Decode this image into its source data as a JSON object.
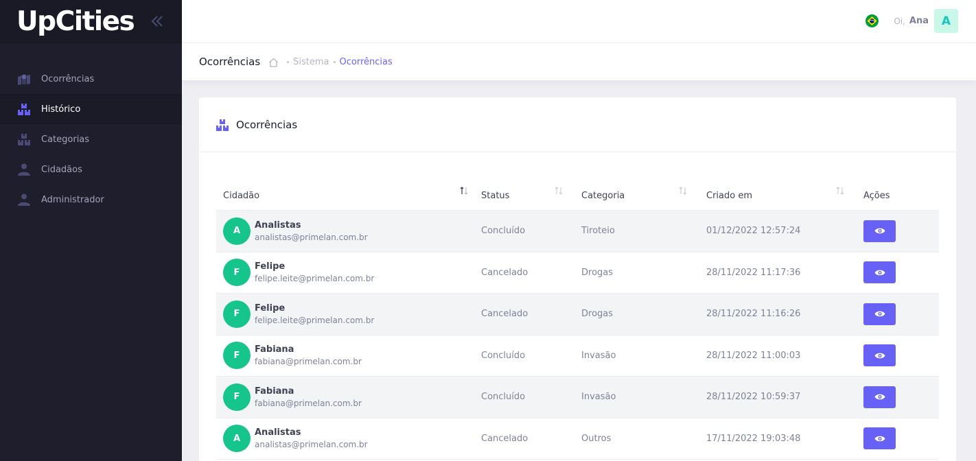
{
  "brand": {
    "logo_text": "UpCities"
  },
  "sidebar": {
    "items": [
      {
        "label": "Ocorrências",
        "icon": "map-pin-icon",
        "active": false
      },
      {
        "label": "Histórico",
        "icon": "boxes-icon",
        "active": true
      },
      {
        "label": "Categorias",
        "icon": "boxes-icon",
        "active": false
      },
      {
        "label": "Cidadãos",
        "icon": "user-icon",
        "active": false
      },
      {
        "label": "Administrador",
        "icon": "user-icon",
        "active": false
      }
    ]
  },
  "header": {
    "greeting": "Oi,",
    "user_name": "Ana",
    "user_initial": "A",
    "language_flag": "brazil-flag-icon"
  },
  "subheader": {
    "title": "Ocorrências",
    "breadcrumb": [
      "Sistema",
      "Ocorrências"
    ]
  },
  "card": {
    "title": "Ocorrências",
    "columns": [
      "Cidadão",
      "Status",
      "Categoria",
      "Criado em",
      "Ações"
    ],
    "rows": [
      {
        "initial": "A",
        "name": "Analistas",
        "email": "analistas@primelan.com.br",
        "status": "Concluído",
        "category": "Tiroteio",
        "created": "01/12/2022 12:57:24"
      },
      {
        "initial": "F",
        "name": "Felipe",
        "email": "felipe.leite@primelan.com.br",
        "status": "Cancelado",
        "category": "Drogas",
        "created": "28/11/2022 11:17:36"
      },
      {
        "initial": "F",
        "name": "Felipe",
        "email": "felipe.leite@primelan.com.br",
        "status": "Cancelado",
        "category": "Drogas",
        "created": "28/11/2022 11:16:26"
      },
      {
        "initial": "F",
        "name": "Fabiana",
        "email": "fabiana@primelan.com.br",
        "status": "Concluído",
        "category": "Invasão",
        "created": "28/11/2022 11:00:03"
      },
      {
        "initial": "F",
        "name": "Fabiana",
        "email": "fabiana@primelan.com.br",
        "status": "Concluído",
        "category": "Invasão",
        "created": "28/11/2022 10:59:37"
      },
      {
        "initial": "A",
        "name": "Analistas",
        "email": "analistas@primelan.com.br",
        "status": "Cancelado",
        "category": "Outros",
        "created": "17/11/2022 19:03:48"
      }
    ]
  },
  "colors": {
    "sidebar_bg": "#1e1e2d",
    "accent": "#6761f5",
    "avatar_green": "#15c58b"
  }
}
